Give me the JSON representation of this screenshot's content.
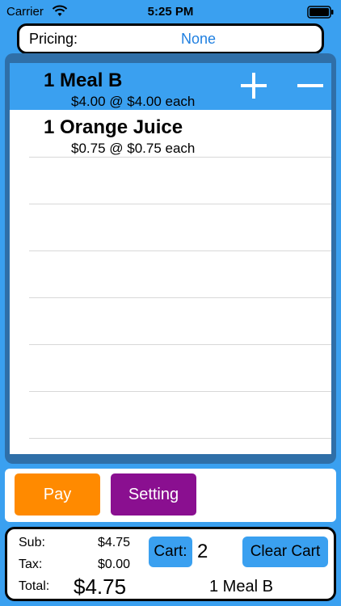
{
  "status": {
    "carrier": "Carrier",
    "time": "5:25 PM"
  },
  "pricing": {
    "label": "Pricing:",
    "value": "None"
  },
  "cart_items": [
    {
      "title": "1 Meal B",
      "detail": "$4.00 @ $4.00 each",
      "selected": true
    },
    {
      "title": "1 Orange Juice",
      "detail": "$0.75 @ $0.75 each",
      "selected": false
    }
  ],
  "actions": {
    "pay_label": "Pay",
    "setting_label": "Setting"
  },
  "totals": {
    "sub_label": "Sub:",
    "sub_value": "$4.75",
    "tax_label": "Tax:",
    "tax_value": "$0.00",
    "total_label": "Total:",
    "total_value": "$4.75",
    "cart_label": "Cart:",
    "cart_count": "2",
    "clear_label": "Clear Cart",
    "last_item": "1  Meal B"
  },
  "colors": {
    "accent": "#3aa0f0",
    "pay": "#ff8a00",
    "setting": "#8a0f90",
    "frame": "#2f6fa8"
  }
}
